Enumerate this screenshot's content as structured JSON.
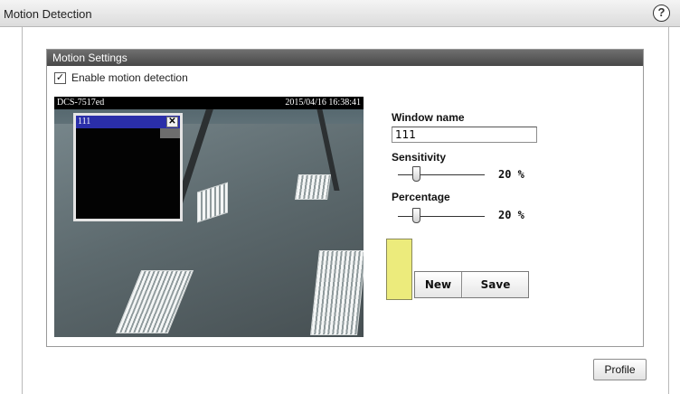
{
  "page": {
    "title": "Motion Detection",
    "help_symbol": "?"
  },
  "settings": {
    "header": "Motion Settings",
    "enable_label": "Enable motion detection",
    "enable_checked": true,
    "check_mark": "✓"
  },
  "video": {
    "camera_name": "DCS-7517ed",
    "timestamp": "2015/04/16 16:38:41",
    "motion_window": {
      "name": "111",
      "close_symbol": "✕"
    }
  },
  "controls": {
    "window_name_label": "Window name",
    "window_name_value": "111",
    "sensitivity_label": "Sensitivity",
    "sensitivity_value": 20,
    "sensitivity_display": "20 %",
    "percentage_label": "Percentage",
    "percentage_value": 20,
    "percentage_display": "20 %",
    "window_color": "#eceb7c",
    "new_button": "New",
    "save_button": "Save"
  },
  "footer": {
    "profile_button": "Profile"
  }
}
